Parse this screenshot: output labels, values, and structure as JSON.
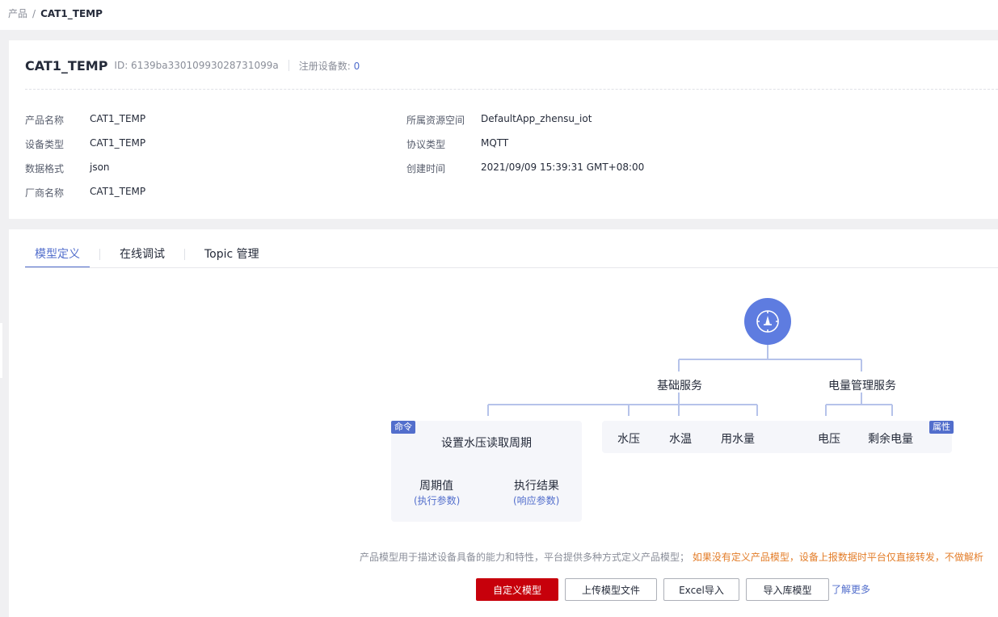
{
  "breadcrumb": {
    "parent": "产品",
    "separator": "/",
    "current": "CAT1_TEMP"
  },
  "product": {
    "name": "CAT1_TEMP",
    "id_text": "ID: 6139ba33010993028731099a",
    "registered_label": "注册设备数:",
    "registered_count": "0"
  },
  "details": {
    "product_name": {
      "label": "产品名称",
      "value": "CAT1_TEMP"
    },
    "device_type": {
      "label": "设备类型",
      "value": "CAT1_TEMP"
    },
    "data_format": {
      "label": "数据格式",
      "value": "json"
    },
    "vendor": {
      "label": "厂商名称",
      "value": "CAT1_TEMP"
    },
    "resource_space": {
      "label": "所属资源空间",
      "value": "DefaultApp_zhensu_iot"
    },
    "protocol": {
      "label": "协议类型",
      "value": "MQTT"
    },
    "created": {
      "label": "创建时间",
      "value": "2021/09/09 15:39:31 GMT+08:00"
    }
  },
  "tabs": [
    {
      "label": "模型定义",
      "active": true
    },
    {
      "label": "在线调试",
      "active": false
    },
    {
      "label": "Topic 管理",
      "active": false
    }
  ],
  "model": {
    "root_icon": "compass-icon",
    "services": {
      "basic": "基础服务",
      "power": "电量管理服务"
    },
    "command_badge": "命令",
    "property_badge": "属性",
    "command": {
      "name": "设置水压读取周期",
      "param": "周期值",
      "param_type": "(执行参数)",
      "result": "执行结果",
      "result_type": "(响应参数)"
    },
    "properties": [
      "水压",
      "水温",
      "用水量",
      "电压",
      "剩余电量"
    ]
  },
  "tip": {
    "normal": "产品模型用于描述设备具备的能力和特性，平台提供多种方式定义产品模型；",
    "warning": "如果没有定义产品模型，设备上报数据时平台仅直接转发，不做解析"
  },
  "actions": {
    "custom": "自定义模型",
    "upload": "上传模型文件",
    "excel": "Excel导入",
    "library": "导入库模型",
    "learn_more": "了解更多"
  },
  "colors": {
    "accent": "#526ecc",
    "primary_button": "#c7000b",
    "warning": "#e37d29",
    "tree_line": "#b6c3ea"
  }
}
